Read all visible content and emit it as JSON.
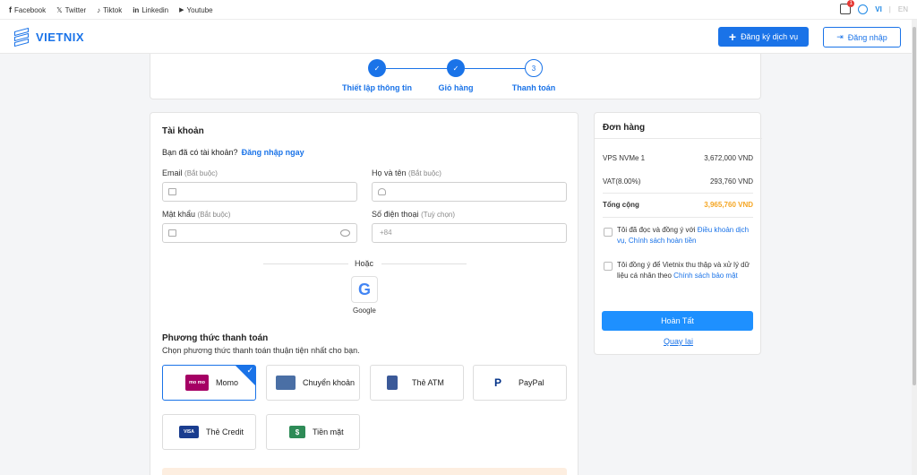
{
  "topbar": {
    "social": [
      {
        "icon": "facebook-icon",
        "glyph": "f",
        "label": "Facebook"
      },
      {
        "icon": "twitter-x-icon",
        "glyph": "𝕏",
        "label": "Twitter"
      },
      {
        "icon": "tiktok-icon",
        "glyph": "♪",
        "label": "Tiktok"
      },
      {
        "icon": "linkedin-icon",
        "glyph": "in",
        "label": "Linkedin"
      },
      {
        "icon": "youtube-icon",
        "glyph": "▶",
        "label": "Youtube"
      }
    ],
    "cart_count": "1",
    "lang_vi": "VI",
    "lang_sep": "|",
    "lang_en": "EN"
  },
  "header": {
    "logo_text": "VIETNIX",
    "register_label": "Đăng ký dịch vụ",
    "login_label": "Đăng nhập"
  },
  "steps": [
    {
      "label": "Thiết lập thông tin",
      "state": "done",
      "marker": "✓"
    },
    {
      "label": "Giỏ hàng",
      "state": "done",
      "marker": "✓"
    },
    {
      "label": "Thanh toán",
      "state": "current",
      "marker": "3"
    }
  ],
  "account": {
    "title": "Tài khoản",
    "have_account": "Bạn đã có tài khoản?",
    "login_now": "Đăng nhập ngay",
    "email_label": "Email",
    "email_req": "(Bắt buộc)",
    "name_label": "Họ và tên",
    "name_req": "(Bắt buộc)",
    "password_label": "Mật khẩu",
    "password_req": "(Bắt buộc)",
    "phone_label": "Số điện thoại",
    "phone_opt": "(Tuỳ chọn)",
    "phone_placeholder": "+84",
    "or_text": "Hoặc",
    "google_label": "Google"
  },
  "payment": {
    "title": "Phương thức thanh toán",
    "subtitle": "Chọn phương thức thanh toán thuận tiện nhất cho bạn.",
    "methods": [
      {
        "label": "Momo",
        "icon": "momo-icon",
        "icon_text": "mo mo",
        "color": "#a50064",
        "selected": true
      },
      {
        "label": "Chuyển khoản",
        "icon": "bank-transfer-icon",
        "icon_text": "",
        "color": "#4a6fa5",
        "selected": false
      },
      {
        "label": "Thẻ ATM",
        "icon": "atm-card-icon",
        "icon_text": "",
        "color": "#3b5998",
        "selected": false
      },
      {
        "label": "PayPal",
        "icon": "paypal-icon",
        "icon_text": "P",
        "color": "#003087",
        "selected": false
      },
      {
        "label": "Thẻ Credit",
        "icon": "credit-card-icon",
        "icon_text": "VISA",
        "color": "#1a3d8f",
        "selected": false
      },
      {
        "label": "Tiền mặt",
        "icon": "cash-icon",
        "icon_text": "$",
        "color": "#2e8b57",
        "selected": false
      }
    ]
  },
  "order": {
    "title": "Đơn hàng",
    "items": [
      {
        "name": "VPS NVMe 1",
        "price": "3,672,000 VND"
      },
      {
        "name": "VAT(8.00%)",
        "price": "293,760 VND"
      }
    ],
    "total_label": "Tổng cộng",
    "total_value": "3,965,760 VND",
    "agree_terms_text": "Tôi đã đọc và đồng ý với ",
    "agree_terms_link": "Điều khoản dịch vụ, Chính sách hoàn tiền",
    "agree_data_text": "Tôi đồng ý để Vietnix thu thập và xử lý dữ liệu cá nhân theo ",
    "agree_data_link": "Chính sách bảo mật",
    "finish_label": "Hoàn Tất",
    "back_label": "Quay lại"
  },
  "colors": {
    "accent": "#1a73e8",
    "total": "#f5a623"
  }
}
